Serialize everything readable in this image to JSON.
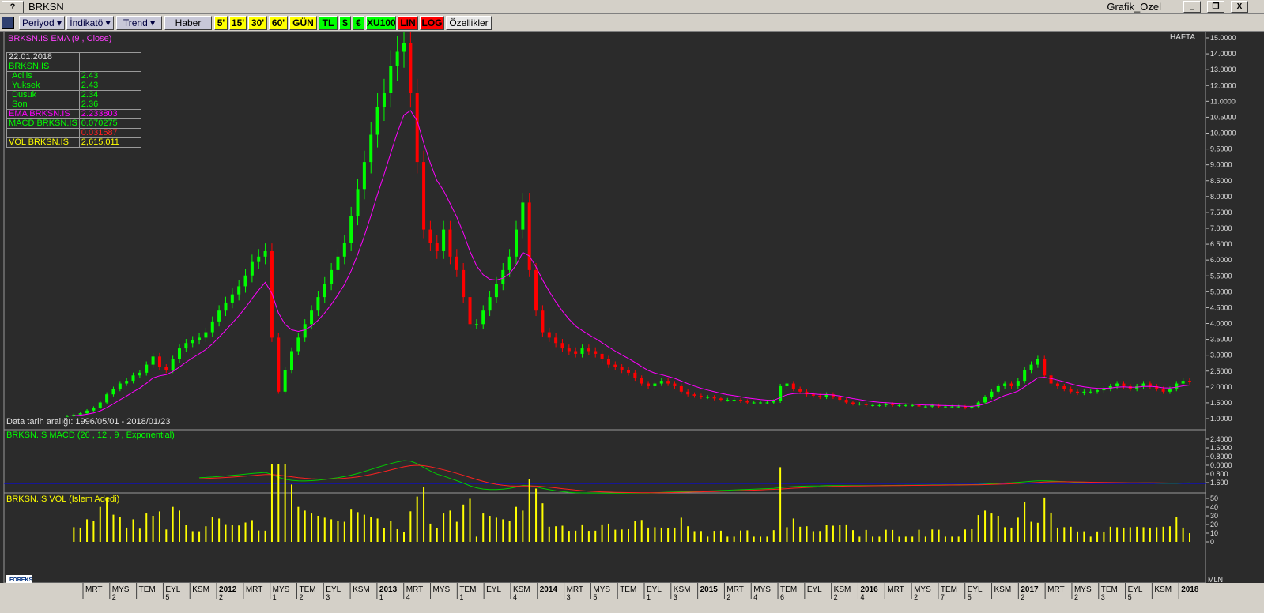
{
  "window": {
    "title": "BRKSN",
    "app_title": "Grafik_Ozel",
    "help_label": "?",
    "minimize_label": "_",
    "restore_label": "❐",
    "close_label": "X"
  },
  "toolbar": {
    "periyod": "Periyod",
    "indikator": "İndikatö",
    "trend": "Trend",
    "haber": "Haber",
    "p5": "5'",
    "p15": "15'",
    "p30": "30'",
    "p60": "60'",
    "gun": "GÜN",
    "tl": "TL",
    "usd": "$",
    "eur": "€",
    "xu100": "XU100",
    "lin": "LIN",
    "log": "LOG",
    "ozellikler": "Özellikler"
  },
  "price_panel": {
    "title": "BRKSN.IS EMA (9 , Close)",
    "period_label": "HAFTA",
    "date_range": "Data tarih aralığı: 1996/05/01 - 2018/01/23",
    "y_ticks": [
      "15.0000",
      "14.0000",
      "13.0000",
      "12.0000",
      "11.0000",
      "10.5000",
      "10.0000",
      "9.5000",
      "9.0000",
      "8.5000",
      "8.0000",
      "7.5000",
      "7.0000",
      "6.5000",
      "6.0000",
      "5.5000",
      "5.0000",
      "4.5000",
      "4.0000",
      "3.5000",
      "3.0000",
      "2.5000",
      "2.0000",
      "1.5000",
      "1.0000"
    ]
  },
  "info_box": {
    "date": "22.01.2018",
    "symbol": "BRKSN.IS",
    "rows": [
      {
        "label": "Acilis",
        "value": "2.43"
      },
      {
        "label": "Yuksek",
        "value": "2.43"
      },
      {
        "label": "Dusuk",
        "value": "2.34"
      },
      {
        "label": "Son",
        "value": "2.36"
      }
    ],
    "ema_label": "EMA BRKSN.IS",
    "ema_value": "2.233803",
    "macd_label": "MACD BRKSN.IS",
    "macd_value": "0.070275",
    "macd_value2": "0.031587",
    "vol_label": "VOL BRKSN.IS",
    "vol_value": "2,615,011"
  },
  "macd_panel": {
    "title": "BRKSN.IS MACD (26 , 12 , 9 , Exponential)",
    "y_ticks": [
      "2.4000",
      "1.6000",
      "0.8000",
      "0.0000",
      "0.800",
      "1.600"
    ]
  },
  "vol_panel": {
    "title": "BRKSN.IS VOL (Islem Adedi)",
    "y_ticks": [
      "50",
      "40",
      "30",
      "20",
      "10",
      "0"
    ],
    "unit": "MLN",
    "brand": "FOREKS"
  },
  "x_axis": [
    {
      "t": "MRT",
      "s": ""
    },
    {
      "t": "MYS",
      "s": "2"
    },
    {
      "t": "TEM",
      "s": ""
    },
    {
      "t": "EYL",
      "s": "5"
    },
    {
      "t": "KSM",
      "s": ""
    },
    {
      "t": "2012",
      "s": "2",
      "b": true
    },
    {
      "t": "MRT",
      "s": ""
    },
    {
      "t": "MYS",
      "s": "1"
    },
    {
      "t": "TEM",
      "s": "2"
    },
    {
      "t": "EYL",
      "s": "3"
    },
    {
      "t": "KSM",
      "s": ""
    },
    {
      "t": "2013",
      "s": "1",
      "b": true
    },
    {
      "t": "MRT",
      "s": "4"
    },
    {
      "t": "MYS",
      "s": ""
    },
    {
      "t": "TEM",
      "s": "1"
    },
    {
      "t": "EYL",
      "s": ""
    },
    {
      "t": "KSM",
      "s": "4"
    },
    {
      "t": "2014",
      "s": "",
      "b": true
    },
    {
      "t": "MRT",
      "s": "3"
    },
    {
      "t": "MYS",
      "s": "5"
    },
    {
      "t": "TEM",
      "s": ""
    },
    {
      "t": "EYL",
      "s": "1"
    },
    {
      "t": "KSM",
      "s": "3"
    },
    {
      "t": "2015",
      "s": "",
      "b": true
    },
    {
      "t": "MRT",
      "s": "2"
    },
    {
      "t": "MYS",
      "s": "4"
    },
    {
      "t": "TEM",
      "s": "6"
    },
    {
      "t": "EYL",
      "s": ""
    },
    {
      "t": "KSM",
      "s": "2"
    },
    {
      "t": "2016",
      "s": "4",
      "b": true
    },
    {
      "t": "MRT",
      "s": ""
    },
    {
      "t": "MYS",
      "s": "2"
    },
    {
      "t": "TEM",
      "s": "7"
    },
    {
      "t": "EYL",
      "s": "5"
    },
    {
      "t": "KSM",
      "s": ""
    },
    {
      "t": "2017",
      "s": "2",
      "b": true
    },
    {
      "t": "MRT",
      "s": ""
    },
    {
      "t": "MYS",
      "s": "2"
    },
    {
      "t": "TEM",
      "s": "3"
    },
    {
      "t": "EYL",
      "s": "5"
    },
    {
      "t": "KSM",
      "s": ""
    },
    {
      "t": "2018",
      "s": "",
      "b": true
    }
  ],
  "colors": {
    "up": "#00ff00",
    "down": "#ff0000",
    "ema": "#ff00ff",
    "macd": "#00cc00",
    "signal": "#ff2020",
    "zero_line": "#0000ff",
    "volume": "#ffff00",
    "background": "#2b2b2b"
  },
  "chart_data": [
    {
      "type": "candlestick",
      "title": "BRKSN.IS EMA (9 , Close)",
      "ylim": [
        1.0,
        15.0
      ],
      "weekly_close_approx": [
        1.1,
        1.15,
        1.2,
        1.3,
        1.4,
        1.6,
        1.9,
        2.1,
        2.3,
        2.4,
        2.6,
        2.7,
        3.0,
        3.3,
        2.9,
        2.8,
        3.2,
        3.6,
        3.8,
        3.9,
        4.0,
        4.2,
        4.6,
        5.0,
        5.3,
        5.6,
        5.9,
        6.3,
        6.8,
        7.0,
        7.2,
        4.0,
        2.0,
        2.8,
        3.5,
        4.0,
        4.5,
        5.0,
        5.5,
        6.0,
        6.5,
        7.0,
        7.5,
        8.5,
        9.5,
        10.5,
        11.5,
        12.5,
        13.0,
        14.0,
        14.5,
        14.8,
        13.0,
        10.5,
        8.0,
        7.5,
        7.2,
        8.0,
        7.0,
        6.5,
        5.5,
        4.5,
        4.5,
        5.0,
        5.5,
        6.0,
        6.5,
        7.0,
        8.0,
        9.0,
        6.5,
        5.0,
        4.2,
        4.0,
        3.8,
        3.6,
        3.5,
        3.4,
        3.6,
        3.5,
        3.4,
        3.2,
        3.0,
        2.9,
        2.8,
        2.7,
        2.5,
        2.3,
        2.2,
        2.3,
        2.4,
        2.3,
        2.2,
        2.0,
        1.9,
        1.85,
        1.8,
        1.8,
        1.75,
        1.7,
        1.7,
        1.7,
        1.65,
        1.6,
        1.6,
        1.6,
        1.6,
        1.65,
        2.2,
        2.3,
        2.1,
        2.0,
        1.9,
        1.85,
        1.8,
        1.9,
        1.8,
        1.7,
        1.6,
        1.55,
        1.55,
        1.5,
        1.5,
        1.5,
        1.55,
        1.5,
        1.5,
        1.5,
        1.5,
        1.45,
        1.45,
        1.5,
        1.45,
        1.45,
        1.45,
        1.45,
        1.4,
        1.45,
        1.6,
        1.8,
        2.0,
        2.2,
        2.3,
        2.2,
        2.4,
        2.8,
        3.0,
        3.2,
        2.6,
        2.3,
        2.2,
        2.1,
        2.0,
        1.95,
        2.0,
        2.0,
        2.05,
        2.1,
        2.2,
        2.3,
        2.2,
        2.1,
        2.2,
        2.3,
        2.2,
        2.1,
        2.0,
        2.1,
        2.3,
        2.4,
        2.36
      ]
    },
    {
      "type": "line",
      "title": "BRKSN.IS MACD (26 , 12 , 9 , Exponential)",
      "ylim": [
        -1.6,
        2.4
      ],
      "series": []
    },
    {
      "type": "bar",
      "title": "BRKSN.IS VOL (Islem Adedi)",
      "ylabel": "MLN",
      "ylim": [
        0,
        50
      ]
    }
  ]
}
